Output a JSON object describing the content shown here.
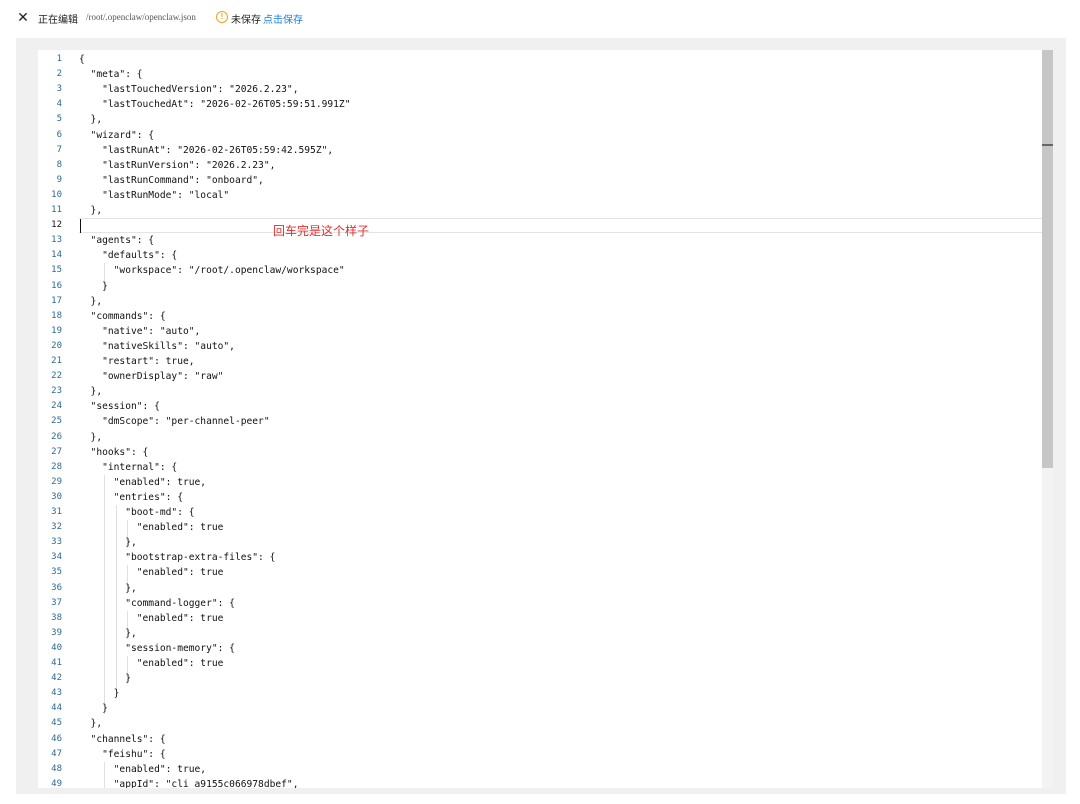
{
  "header": {
    "close_icon": "close-icon",
    "editing_label": "正在编辑",
    "file_path": "/root/.openclaw/openclaw.json",
    "warning_icon": "warning-circle-icon",
    "unsaved_label": "未保存",
    "save_link": "点击保存"
  },
  "editor": {
    "active_line": 12,
    "annotation": "回车完是这个样子",
    "lines": [
      "{",
      "  \"meta\": {",
      "    \"lastTouchedVersion\": \"2026.2.23\",",
      "    \"lastTouchedAt\": \"2026-02-26T05:59:51.991Z\"",
      "  },",
      "  \"wizard\": {",
      "    \"lastRunAt\": \"2026-02-26T05:59:42.595Z\",",
      "    \"lastRunVersion\": \"2026.2.23\",",
      "    \"lastRunCommand\": \"onboard\",",
      "    \"lastRunMode\": \"local\"",
      "  },",
      "",
      "  \"agents\": {",
      "    \"defaults\": {",
      "      \"workspace\": \"/root/.openclaw/workspace\"",
      "    }",
      "  },",
      "  \"commands\": {",
      "    \"native\": \"auto\",",
      "    \"nativeSkills\": \"auto\",",
      "    \"restart\": true,",
      "    \"ownerDisplay\": \"raw\"",
      "  },",
      "  \"session\": {",
      "    \"dmScope\": \"per-channel-peer\"",
      "  },",
      "  \"hooks\": {",
      "    \"internal\": {",
      "      \"enabled\": true,",
      "      \"entries\": {",
      "        \"boot-md\": {",
      "          \"enabled\": true",
      "        },",
      "        \"bootstrap-extra-files\": {",
      "          \"enabled\": true",
      "        },",
      "        \"command-logger\": {",
      "          \"enabled\": true",
      "        },",
      "        \"session-memory\": {",
      "          \"enabled\": true",
      "        }",
      "      }",
      "    }",
      "  },",
      "  \"channels\": {",
      "    \"feishu\": {",
      "      \"enabled\": true,",
      "      \"appId\": \"cli_a9155c066978dbef\","
    ]
  }
}
